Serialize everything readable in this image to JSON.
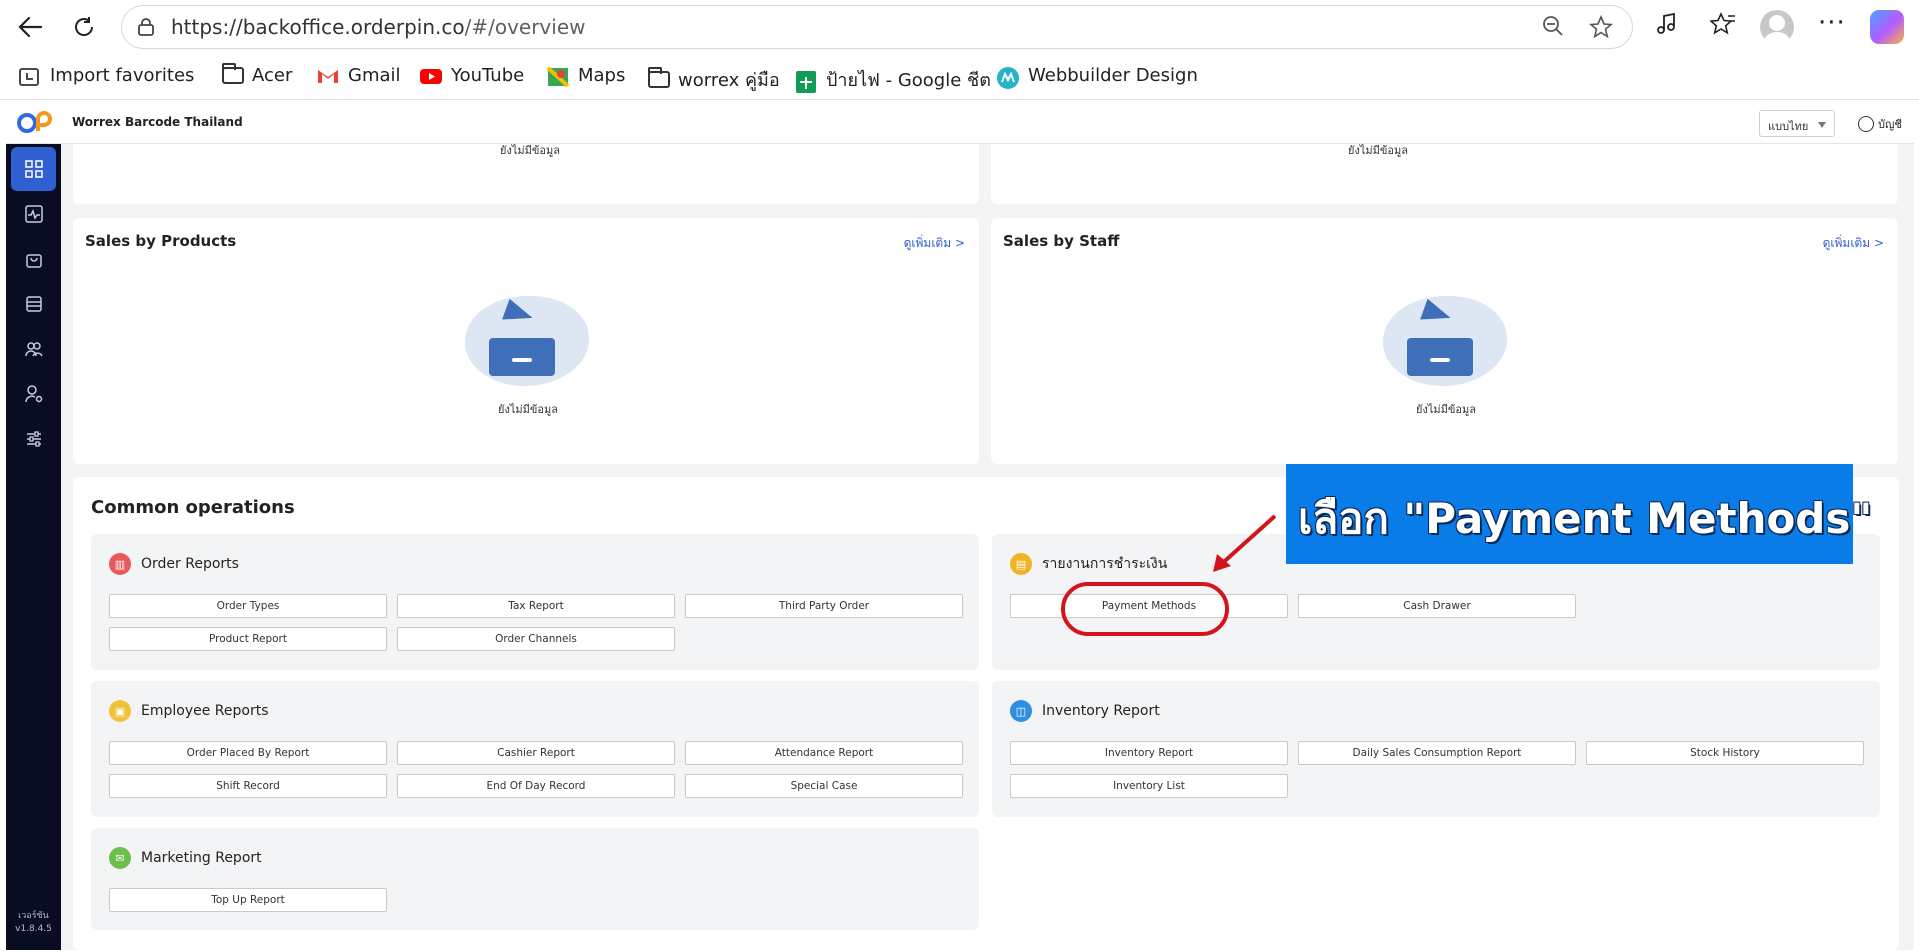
{
  "browser": {
    "url_host": "https://backoffice.orderpin.co",
    "url_path": "/#/overview"
  },
  "favorites": [
    {
      "label": "Import favorites",
      "icon": "import-icon"
    },
    {
      "label": "Acer",
      "icon": "folder-icon"
    },
    {
      "label": "Gmail",
      "icon": "gmail-icon"
    },
    {
      "label": "YouTube",
      "icon": "youtube-icon"
    },
    {
      "label": "Maps",
      "icon": "maps-icon"
    },
    {
      "label": "worrex คู่มือ",
      "icon": "folder-icon"
    },
    {
      "label": "ป้ายไฟ - Google ชีต",
      "icon": "sheets-icon"
    },
    {
      "label": "Webbuilder Design",
      "icon": "webbuilder-icon"
    }
  ],
  "header": {
    "company": "Worrex Barcode Thailand",
    "language": "แบบไทย",
    "account": "บัญชี"
  },
  "sidebar": {
    "items": [
      {
        "name": "dashboard-icon",
        "active": true
      },
      {
        "name": "activity-icon",
        "active": false
      },
      {
        "name": "shopping-bag-icon",
        "active": false
      },
      {
        "name": "inventory-icon",
        "active": false
      },
      {
        "name": "users-icon",
        "active": false
      },
      {
        "name": "user-settings-icon",
        "active": false
      },
      {
        "name": "sliders-icon",
        "active": false
      }
    ],
    "version_label": "เวอร์ชัน",
    "version": "v1.8.4.5"
  },
  "top_cards": {
    "empty_text": "ยังไม่มีข้อมูล"
  },
  "sales_products": {
    "title": "Sales by Products",
    "see_more": "ดูเพิ่มเติม >",
    "empty_text": "ยังไม่มีข้อมูล"
  },
  "sales_staff": {
    "title": "Sales by Staff",
    "see_more": "ดูเพิ่มเติม >",
    "empty_text": "ยังไม่มีข้อมูล"
  },
  "common": {
    "title": "Common operations",
    "order_reports": {
      "title": "Order Reports",
      "buttons": [
        "Order Types",
        "Tax Report",
        "Third Party Order",
        "Product Report",
        "Order Channels"
      ]
    },
    "payment_reports": {
      "title": "รายงานการชำระเงิน",
      "buttons": [
        "Payment Methods",
        "Cash Drawer"
      ]
    },
    "employee_reports": {
      "title": "Employee Reports",
      "buttons": [
        "Order Placed By Report",
        "Cashier Report",
        "Attendance Report",
        "Shift Record",
        "End Of Day Record",
        "Special Case"
      ]
    },
    "inventory_reports": {
      "title": "Inventory Report",
      "buttons": [
        "Inventory Report",
        "Daily Sales Consumption Report",
        "Stock History",
        "Inventory List"
      ]
    },
    "marketing_reports": {
      "title": "Marketing Report",
      "buttons": [
        "Top Up Report"
      ]
    }
  },
  "annotation": {
    "text": "เลือก \"Payment Methods\"",
    "color": "#0a7ce8",
    "ring_color": "#d4141c"
  }
}
